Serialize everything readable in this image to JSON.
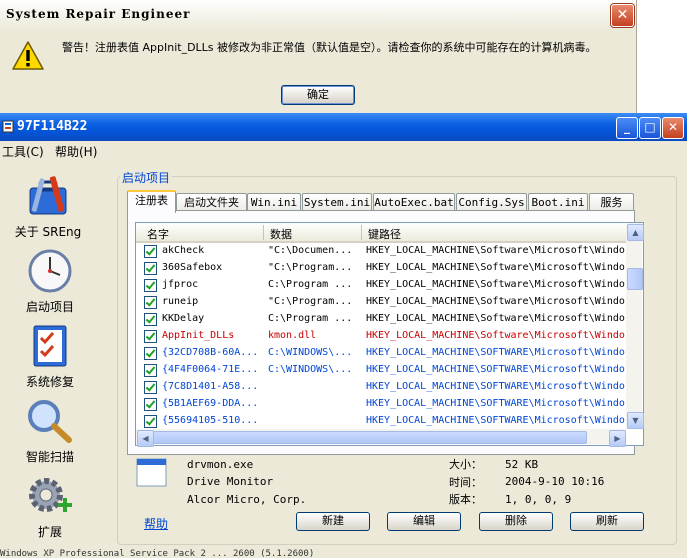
{
  "alert": {
    "title": "System Repair Engineer",
    "message": "警告！注册表值 AppInit_DLLs 被修改为非正常值（默认值是空）。请检查你的系统中可能存在的计算机病毒。",
    "ok_label": "确定",
    "close_glyph": "✕"
  },
  "window": {
    "title": "97F114B22",
    "menu": [
      "工具(C)",
      "帮助(H)"
    ]
  },
  "sidebar": {
    "items": [
      {
        "label": "关于 SREng",
        "icon": "toolbox-icon"
      },
      {
        "label": "启动项目",
        "icon": "clock-icon"
      },
      {
        "label": "系统修复",
        "icon": "checklist-icon"
      },
      {
        "label": "智能扫描",
        "icon": "magnifier-icon"
      },
      {
        "label": "扩展",
        "icon": "gear-plus-icon"
      }
    ]
  },
  "group_title": "启动项目",
  "tabs": [
    "注册表",
    "启动文件夹",
    "Win.ini",
    "System.ini",
    "AutoExec.bat",
    "Config.Sys",
    "Boot.ini",
    "服务"
  ],
  "columns": [
    "名字",
    "数据",
    "键路径"
  ],
  "rows": [
    {
      "name": "akCheck",
      "data": "\"C:\\Documen...",
      "path": "HKEY_LOCAL_MACHINE\\Software\\Microsoft\\Windo.",
      "color": "black"
    },
    {
      "name": "360Safebox",
      "data": "\"C:\\Program...",
      "path": "HKEY_LOCAL_MACHINE\\Software\\Microsoft\\Windo.",
      "color": "black"
    },
    {
      "name": "jfproc",
      "data": "C:\\Program ...",
      "path": "HKEY_LOCAL_MACHINE\\Software\\Microsoft\\Windo.",
      "color": "black"
    },
    {
      "name": "runeip",
      "data": "\"C:\\Program...",
      "path": "HKEY_LOCAL_MACHINE\\Software\\Microsoft\\Windo.",
      "color": "black"
    },
    {
      "name": "KKDelay",
      "data": "C:\\Program ...",
      "path": "HKEY_LOCAL_MACHINE\\Software\\Microsoft\\Windo.",
      "color": "black"
    },
    {
      "name": "AppInit_DLLs",
      "data": "kmon.dll",
      "path": "HKEY_LOCAL_MACHINE\\Software\\Microsoft\\Windo.",
      "color": "red"
    },
    {
      "name": "{32CD708B-60A...",
      "data": "C:\\WINDOWS\\...",
      "path": "HKEY_LOCAL_MACHINE\\SOFTWARE\\Microsoft\\Windo.",
      "color": "blue"
    },
    {
      "name": "{4F4F0064-71E...",
      "data": "C:\\WINDOWS\\...",
      "path": "HKEY_LOCAL_MACHINE\\SOFTWARE\\Microsoft\\Windo.",
      "color": "blue"
    },
    {
      "name": "{7C8D1401-A58...",
      "data": "",
      "path": "HKEY_LOCAL_MACHINE\\SOFTWARE\\Microsoft\\Windo.",
      "color": "blue"
    },
    {
      "name": "{5B1AEF69-DDA...",
      "data": "",
      "path": "HKEY_LOCAL_MACHINE\\SOFTWARE\\Microsoft\\Windo.",
      "color": "blue"
    },
    {
      "name": "{55694105-510...",
      "data": "",
      "path": "HKEY_LOCAL_MACHINE\\SOFTWARE\\Microsoft\\Windo.",
      "color": "blue"
    }
  ],
  "details": {
    "file": "drvmon.exe",
    "description": "Drive Monitor",
    "company": "Alcor Micro, Corp.",
    "size_label": "大小：",
    "size": "52 KB",
    "time_label": "时间：",
    "time": "2004-9-10 10:16",
    "version_label": "版本：",
    "version": "1, 0, 0, 9"
  },
  "buttons": {
    "help": "帮助",
    "new": "新建",
    "edit": "编辑",
    "delete": "删除",
    "refresh": "刷新"
  },
  "status_text": "Windows XP Professional Service Pack 2 ... 2600 (5.1.2600)"
}
